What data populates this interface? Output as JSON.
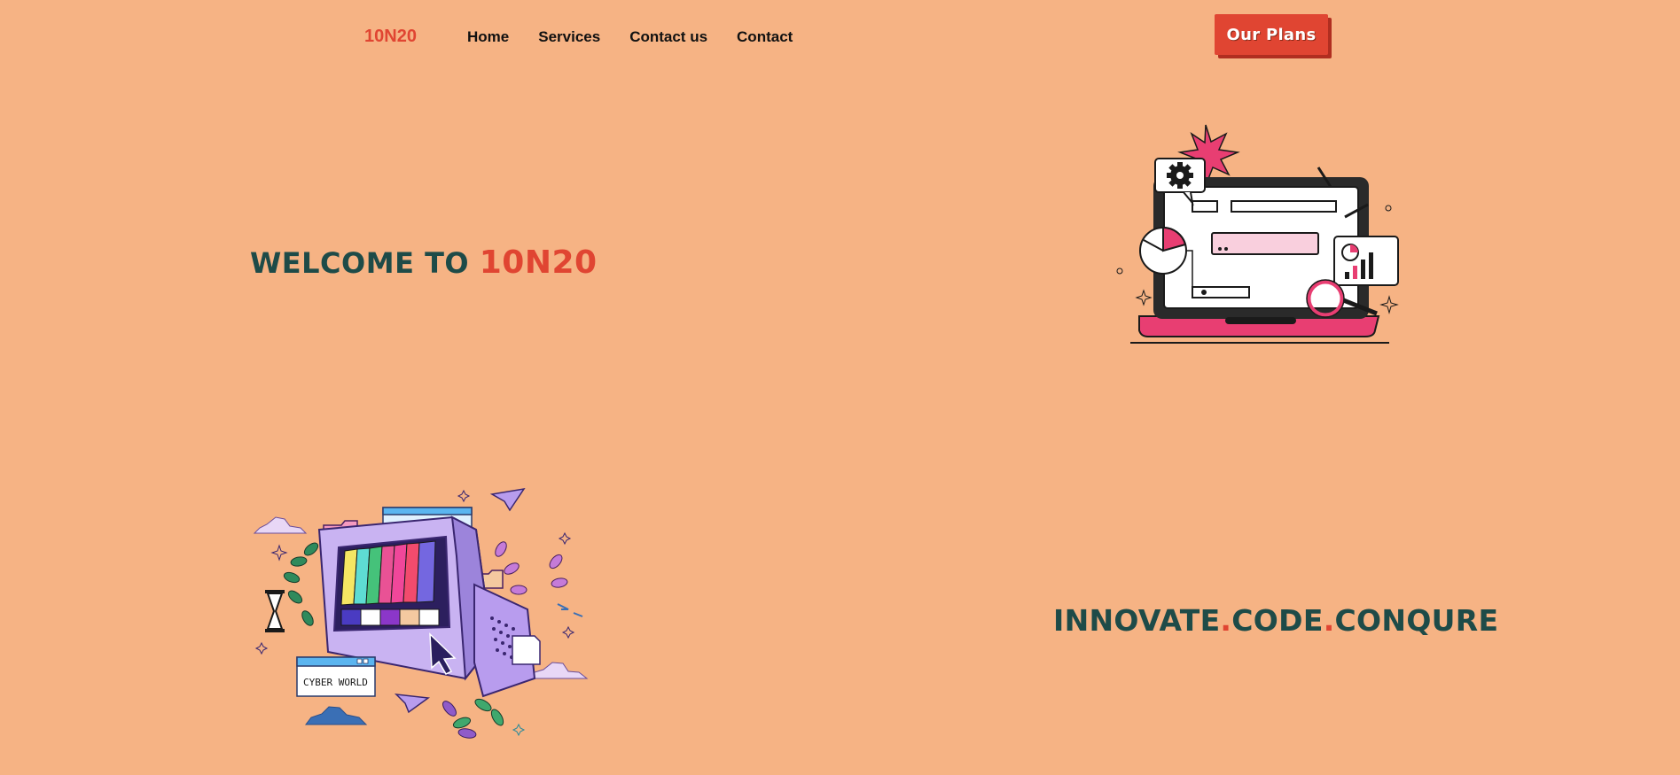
{
  "nav": {
    "brand": "10N20",
    "links": [
      "Home",
      "Services",
      "Contact us",
      "Contact"
    ],
    "cta": "Our Plans"
  },
  "hero": {
    "welcome_prefix": "Welcome to",
    "welcome_brand": "10N20"
  },
  "illustrations": {
    "retro_pc_window_label": "CYBER WORLD"
  },
  "tagline": {
    "part1": "Innovate",
    "part2": "Code",
    "part3": "Conqure",
    "separator": "."
  },
  "colors": {
    "background": "#F6B384",
    "accent": "#E04532",
    "heading": "#1E4B48",
    "pink": "#E83E72"
  }
}
